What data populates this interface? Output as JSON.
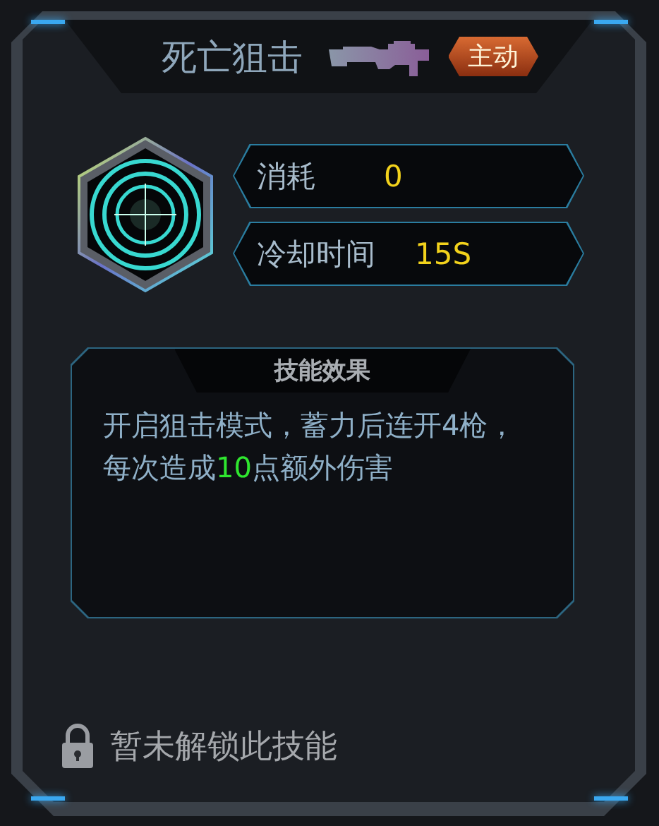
{
  "title": "死亡狙击",
  "skill_type": "主动",
  "stats": [
    {
      "label": "消耗",
      "value": "0"
    },
    {
      "label": "冷却时间",
      "value": "15S"
    }
  ],
  "effect": {
    "heading": "技能效果",
    "segments": [
      {
        "text": "开启狙击模式，蓄力后连开4枪，每次造成",
        "highlight": false
      },
      {
        "text": "10",
        "highlight": true
      },
      {
        "text": "点额外伤害",
        "highlight": false
      }
    ]
  },
  "lock": {
    "locked": true,
    "text": "暂未解锁此技能"
  }
}
